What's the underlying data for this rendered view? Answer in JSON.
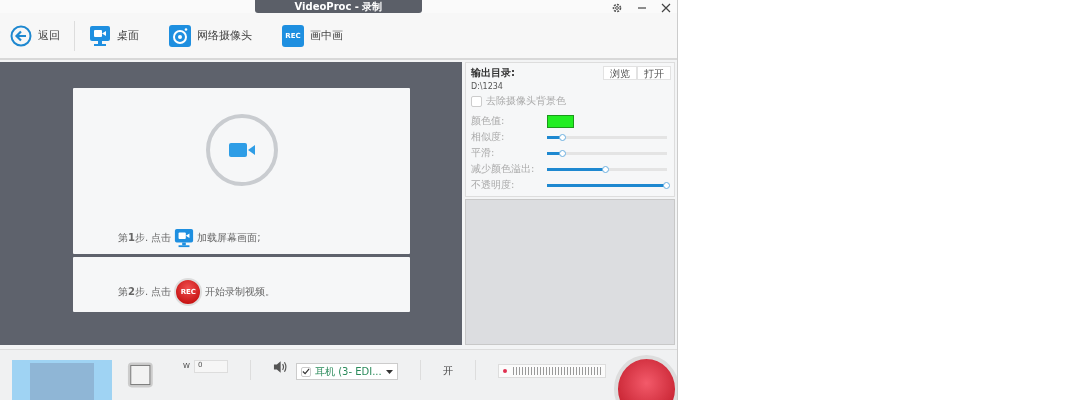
{
  "window": {
    "title": "VideoProc - 录制"
  },
  "toolbar": [
    {
      "kind": "back",
      "label": "返回"
    },
    {
      "kind": "screen",
      "label": "桌面"
    },
    {
      "kind": "camera",
      "label": "网络摄像头"
    },
    {
      "kind": "pip",
      "label": "画中画",
      "icon_text": "REC"
    }
  ],
  "steps": [
    {
      "kind": "screen",
      "before": "第**1**步. 点击",
      "after": "加载屏幕画面;"
    },
    {
      "kind": "rec",
      "before": "第**2**步. 点击",
      "after": "开始录制视频。",
      "icon_text": "REC"
    }
  ],
  "output": {
    "label": "输出目录:",
    "path": "D:\\1234",
    "buttons": [
      "浏览",
      "打开"
    ]
  },
  "remove_background": {
    "label": "去除摄像头背景色",
    "checked": false
  },
  "color_value": {
    "label": "颜色值:",
    "color": "#22ee22"
  },
  "sliders": [
    {
      "label": "相似度:",
      "level": 0.13
    },
    {
      "label": "平滑:",
      "level": 0.13
    },
    {
      "label": "减少颜色溢出:",
      "level": 0.49
    },
    {
      "label": "不透明度:",
      "level": 1.0
    }
  ],
  "bottom": {
    "width_label": "W",
    "width_value": "0",
    "audio_device": {
      "label": "耳机 (3- EDI...",
      "checked": true
    },
    "toggle_label": "开"
  }
}
